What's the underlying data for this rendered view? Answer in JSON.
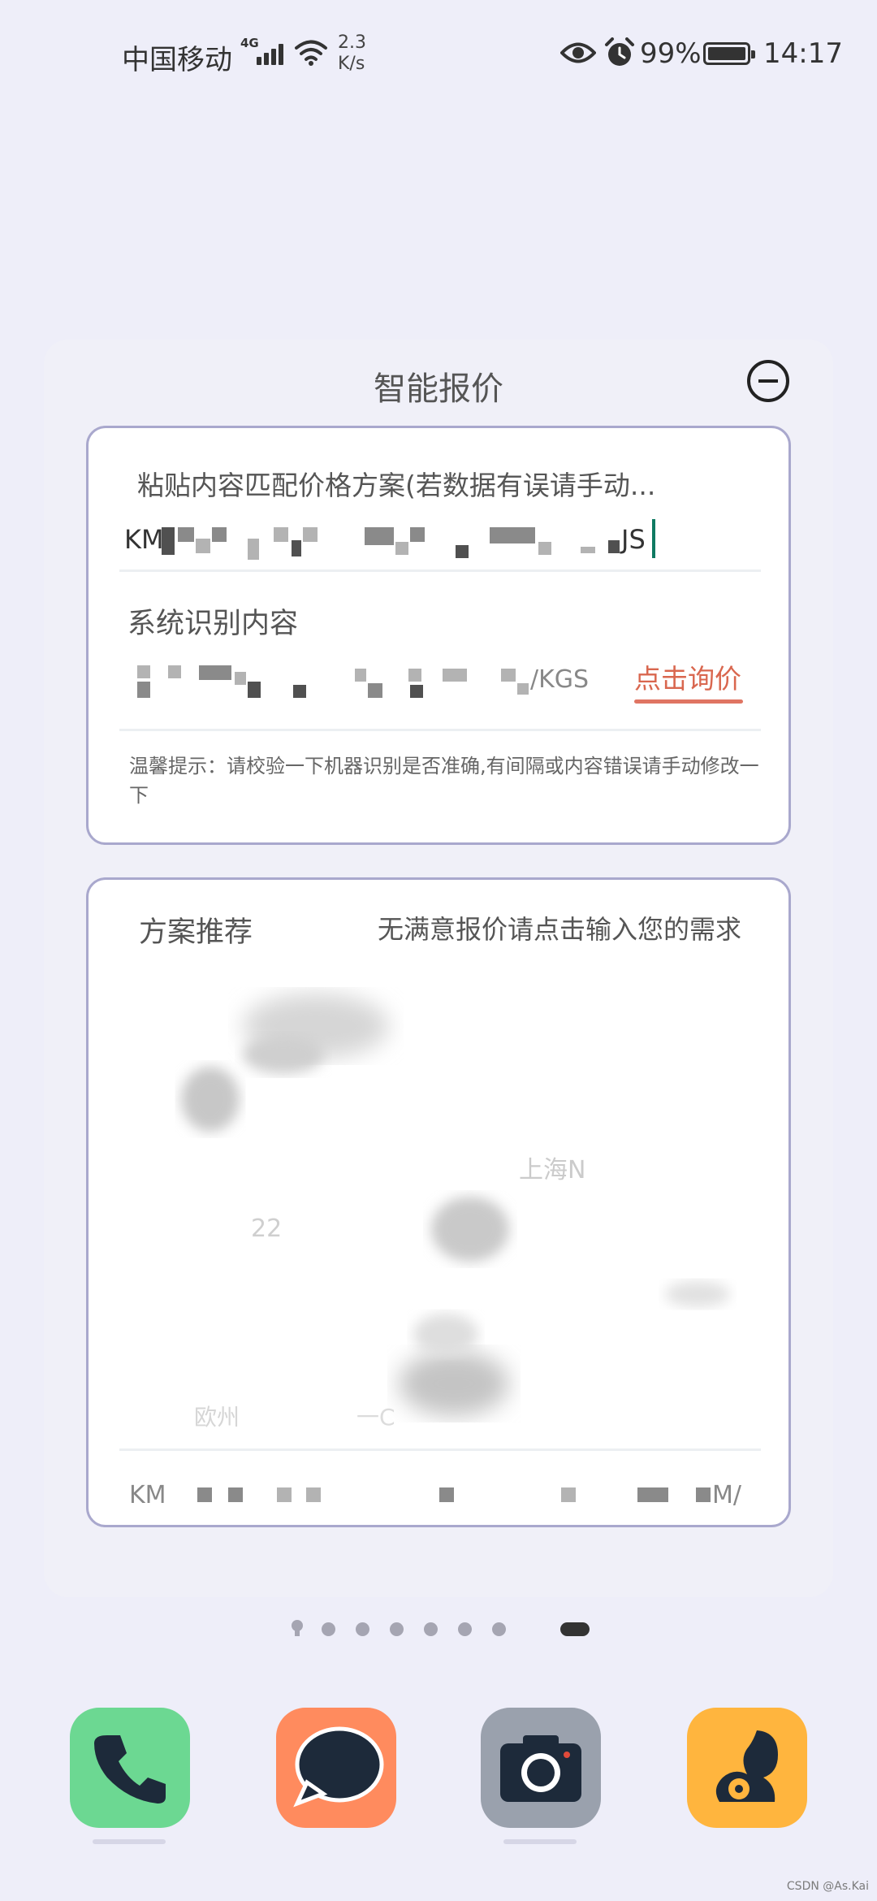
{
  "status_bar": {
    "carrier": "中国移动",
    "network_type": "4G",
    "net_speed": "2.3",
    "net_speed_unit": "K/s",
    "battery_percent": "99%",
    "battery_level": 0.99,
    "time": "14:17"
  },
  "widget": {
    "title": "智能报价",
    "paste_label": "粘贴内容匹配价格方案(若数据有误请手动...",
    "paste_text_prefix": "KM",
    "paste_text_suffix": "JS",
    "recognized_label": "系统识别内容",
    "recognized_value_suffix": "/KGS",
    "query_button": "点击询价",
    "tip": "温馨提示：请校验一下机器识别是否准确,有间隔或内容错误请手动修改一下",
    "recommend_title": "方案推荐",
    "recommend_hint": "无满意报价请点击输入您的需求",
    "plan_items": [
      "上海N",
      "22",
      "欧州",
      "一C"
    ],
    "footer_prefix": "KM",
    "footer_suffix": "M/"
  },
  "pager": {
    "total_dots": 7,
    "active_index": 7
  },
  "dock": {
    "apps": [
      "phone-icon",
      "message-icon",
      "camera-icon",
      "uc-browser-icon"
    ],
    "colors": {
      "phone": "#6cd892",
      "message": "#ff8b5e",
      "camera": "#9aa1ad",
      "uc": "#ffb53e"
    }
  },
  "watermark": "CSDN @As.Kai"
}
